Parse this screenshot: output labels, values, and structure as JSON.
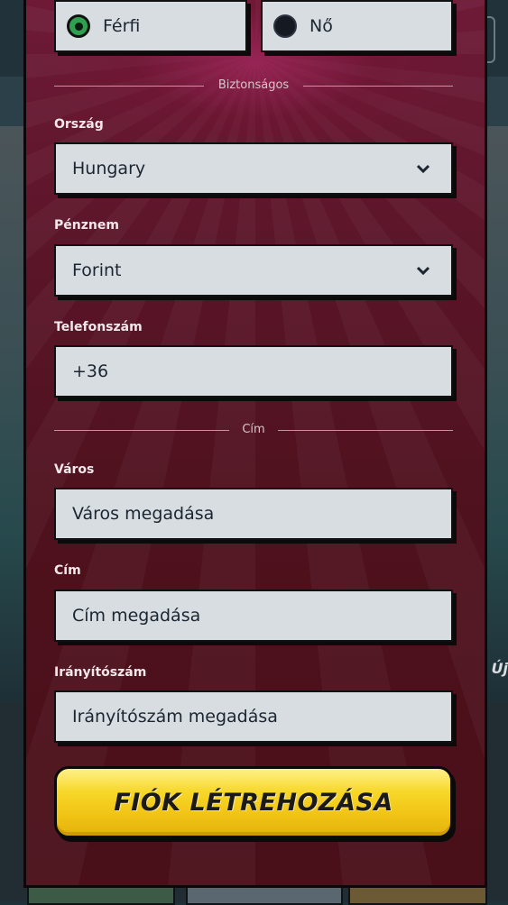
{
  "background": {
    "side_text": "Új"
  },
  "gender": {
    "male_label": "Férfi",
    "female_label": "Nő",
    "selected": "male"
  },
  "security_section": {
    "divider_label": "Biztonságos",
    "country": {
      "label": "Ország",
      "value": "Hungary"
    },
    "currency": {
      "label": "Pénznem",
      "value": "Forint"
    },
    "phone": {
      "label": "Telefonszám",
      "value": "+36"
    }
  },
  "address_section": {
    "divider_label": "Cím",
    "city": {
      "label": "Város",
      "placeholder": "Város megadása"
    },
    "address": {
      "label": "Cím",
      "placeholder": "Cím megadása"
    },
    "postal": {
      "label": "Irányítószám",
      "placeholder": "Irányítószám megadása"
    }
  },
  "submit_label": "FIÓK LÉTREHOZÁSA",
  "colors": {
    "modal_bg": "#4e111d",
    "field_bg": "#d8dde2",
    "radio_selected": "#2fa050",
    "submit_yellow": "#f7d728"
  },
  "icons": {
    "select_arrow": "chevron-down-icon"
  }
}
